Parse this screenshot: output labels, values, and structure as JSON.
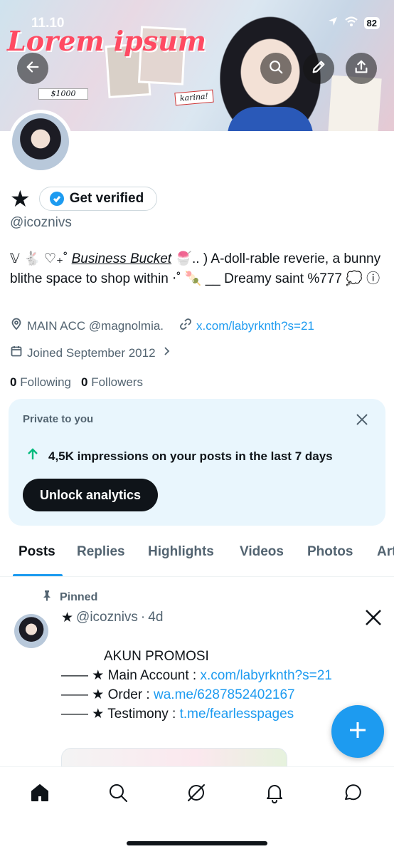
{
  "status": {
    "time": "11.10",
    "battery": "82"
  },
  "banner": {
    "lorem_text": "Lorem ipsum",
    "price_tag": "$1000",
    "karina_tag": "karina!"
  },
  "profile": {
    "display_name": "★",
    "verify_label": "Get verified",
    "handle": "@icoznivs",
    "bio_prefix": "𝕍 🐇 ♡₊˚ ",
    "bio_link": "Business Bucket",
    "bio_rest": " 🍧.. ) A-doll-rable reverie, a bunny blithe space to shop within ⋅˚ 🍡 __ Dreamy saint %777 💭 ⓘ",
    "location": "MAIN ACC @magnolmia.",
    "website": "x.com/labyrknth?s=21",
    "joined": "Joined September 2012",
    "following_count": "0",
    "following_label": "Following",
    "followers_count": "0",
    "followers_label": "Followers"
  },
  "analytics_card": {
    "label": "Private to you",
    "stat": "4,5K impressions on your posts in the last 7 days",
    "button": "Unlock analytics"
  },
  "tabs": [
    {
      "label": "Posts"
    },
    {
      "label": "Replies"
    },
    {
      "label": "Highlights"
    },
    {
      "label": "Videos"
    },
    {
      "label": "Photos"
    },
    {
      "label": "Articles"
    }
  ],
  "pinned_post": {
    "pinned_label": "Pinned",
    "author": "★",
    "handle": "@icoznivs",
    "dot": "·",
    "time": "4d",
    "title": "AKUN PROMOSI",
    "line1_prefix": "—— ★ Main Account : ",
    "line1_link": "x.com/labyrknth?s=21",
    "line2_prefix": "—— ★ Order : ",
    "line2_link": "wa.me/6287852402167",
    "line3_prefix": "—— ★ Testimony : ",
    "line3_link": "t.me/fearlesspages"
  },
  "colors": {
    "accent": "#1d9bf0",
    "text": "#0f1419",
    "muted": "#536471",
    "card_bg": "#e9f6fd",
    "stat_arrow": "#00ba7c"
  },
  "icons": [
    "back-arrow-icon",
    "search-icon",
    "edit-icon",
    "share-icon",
    "location-icon",
    "link-icon",
    "calendar-icon",
    "close-icon",
    "arrow-up-icon",
    "pin-icon",
    "x-logo-icon",
    "plus-icon",
    "home-icon",
    "search-nav-icon",
    "grok-icon",
    "bell-icon",
    "chat-icon"
  ]
}
